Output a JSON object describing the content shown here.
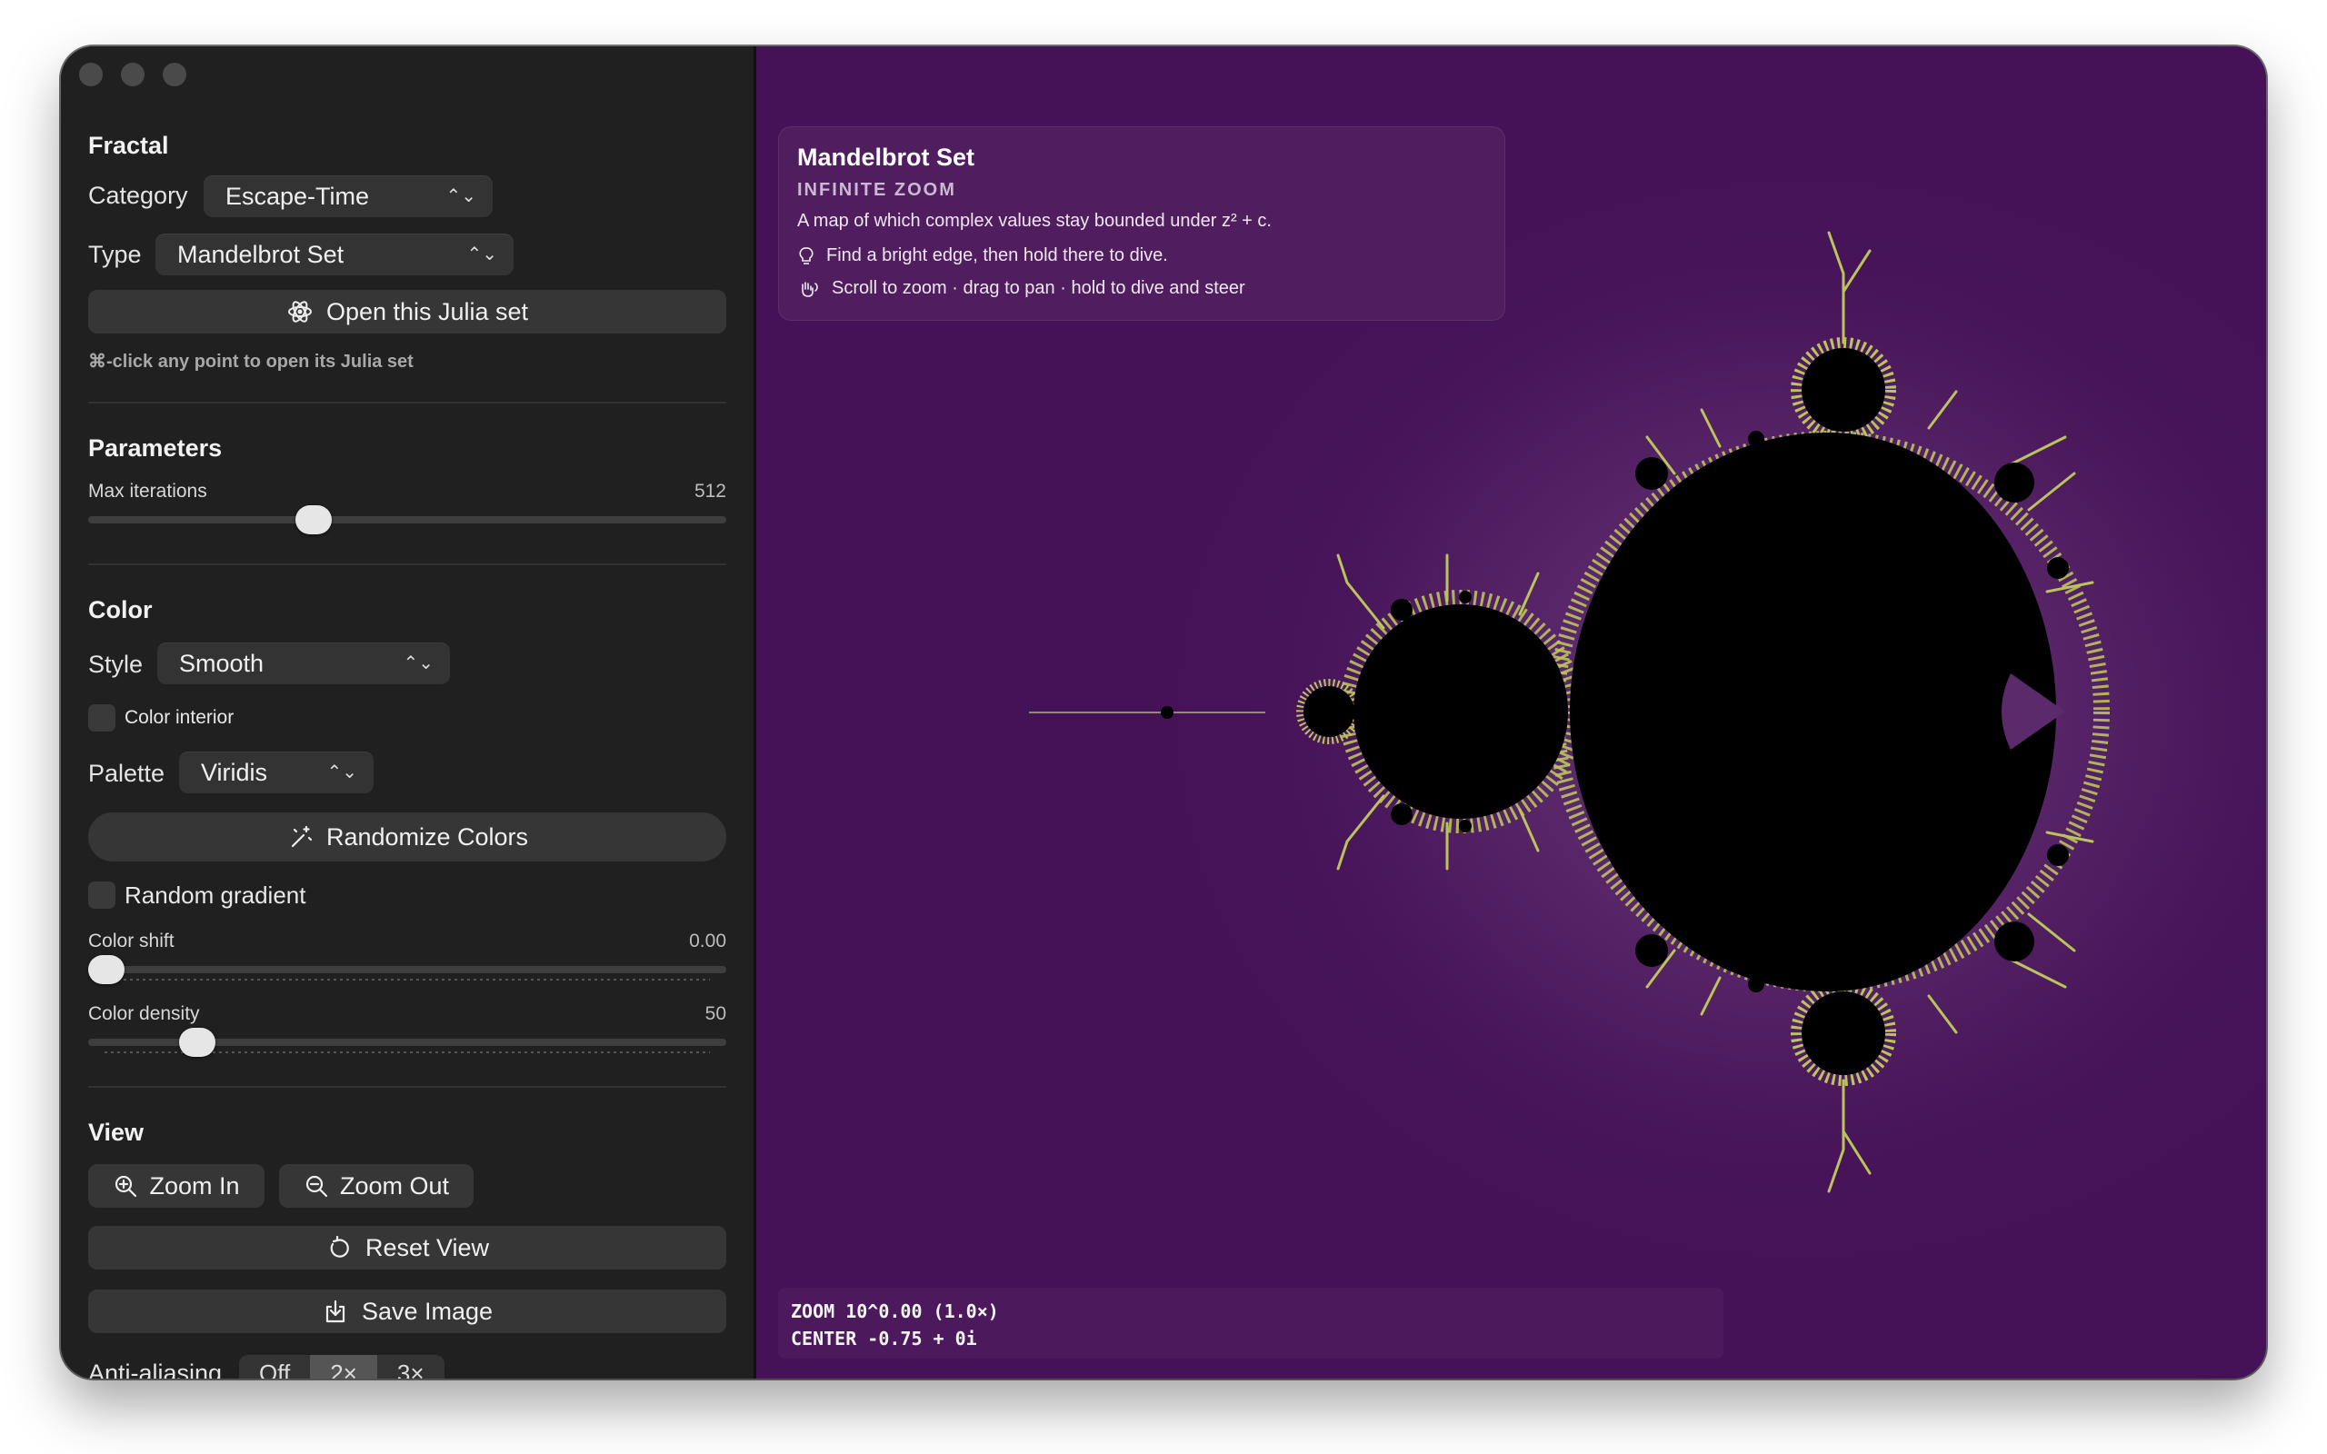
{
  "sidebar": {
    "fractal": {
      "title": "Fractal",
      "category_label": "Category",
      "category_value": "Escape-Time",
      "type_label": "Type",
      "type_value": "Mandelbrot Set",
      "julia_button": "Open this Julia set",
      "hint": "⌘-click any point to open its Julia set"
    },
    "parameters": {
      "title": "Parameters",
      "max_iterations_label": "Max iterations",
      "max_iterations_value": "512"
    },
    "color": {
      "title": "Color",
      "style_label": "Style",
      "style_value": "Smooth",
      "color_interior_label": "Color interior",
      "color_interior_checked": false,
      "palette_label": "Palette",
      "palette_value": "Viridis",
      "randomize_button": "Randomize Colors",
      "random_gradient_label": "Random gradient",
      "random_gradient_checked": false,
      "shift_label": "Color shift",
      "shift_value": "0.00",
      "density_label": "Color density",
      "density_value": "50"
    },
    "view": {
      "title": "View",
      "zoom_in": "Zoom In",
      "zoom_out": "Zoom Out",
      "reset": "Reset View",
      "save": "Save Image",
      "antialias_label": "Anti-aliasing",
      "antialias_options": [
        "Off",
        "2×",
        "3×"
      ],
      "antialias_selected": "2×"
    }
  },
  "canvas": {
    "info": {
      "title": "Mandelbrot Set",
      "subtitle": "INFINITE ZOOM",
      "description": "A map of which complex values stay bounded under z² + c.",
      "tip1": "Find a bright edge, then hold there to dive.",
      "tip2": "Scroll to zoom · drag to pan · hold to dive and steer"
    },
    "status": {
      "zoom": "ZOOM  10^0.00  (1.0×)",
      "center": "CENTER  -0.75 + 0i"
    }
  },
  "colors": {
    "background": "#471459",
    "edge": "#b9c45a",
    "set": "#000000"
  },
  "icons": [
    "atom-icon",
    "magic-wand-icon",
    "zoom-in-icon",
    "zoom-out-icon",
    "reset-icon",
    "save-icon",
    "lightbulb-icon",
    "hand-icon"
  ]
}
